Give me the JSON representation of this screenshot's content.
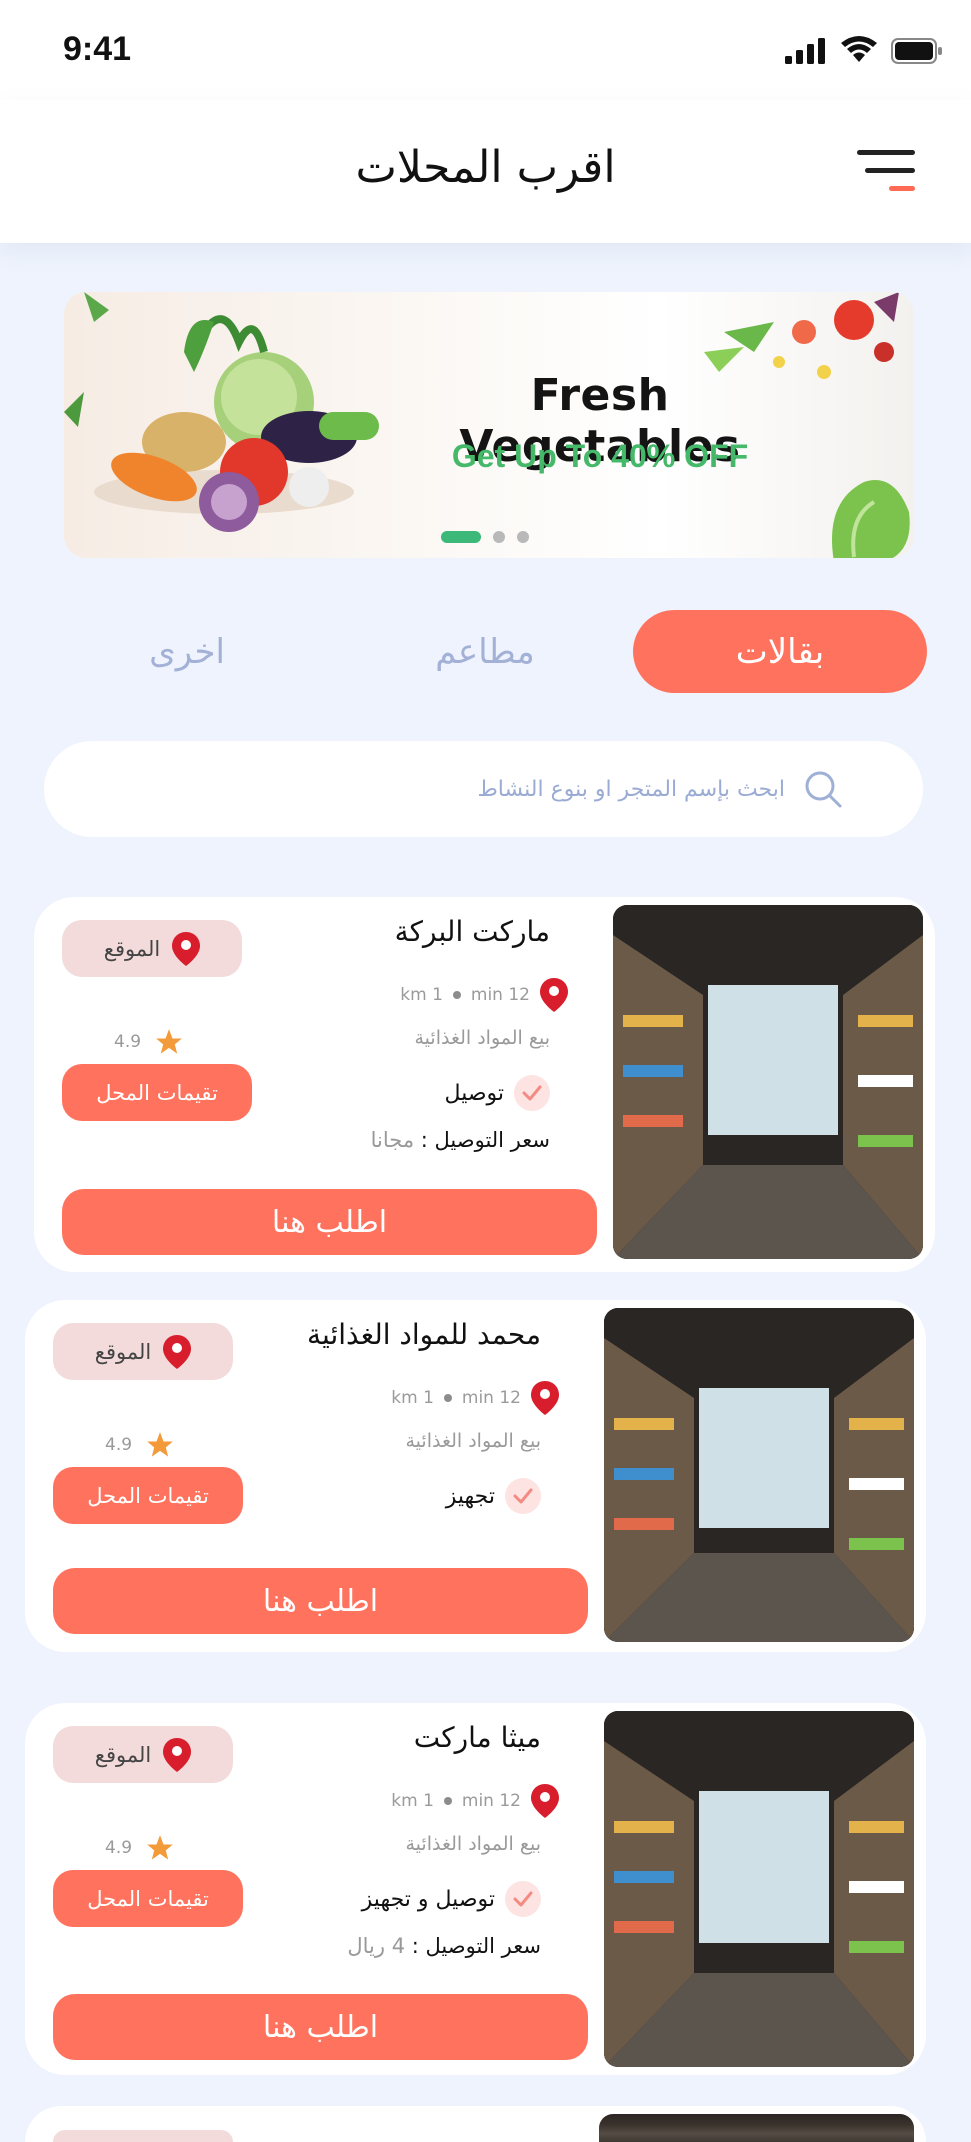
{
  "status_bar": {
    "time": "9:41"
  },
  "header": {
    "title": "اقرب المحلات"
  },
  "banner": {
    "title": "Fresh Vegetables",
    "subtitle": "Get Up To 40% OFF",
    "active_slide": 1,
    "slide_count": 3
  },
  "tabs": [
    {
      "label": "بقالات",
      "active": true
    },
    {
      "label": "مطاعم",
      "active": false
    },
    {
      "label": "اخرى",
      "active": false
    }
  ],
  "search": {
    "placeholder": "ابحث بإسم المتجر او بنوع النشاط",
    "value": ""
  },
  "colors": {
    "accent": "#ff735e",
    "location_chip": "#f3dbdb",
    "subtitle_green": "#45b86a",
    "pin_red": "#d81e2c",
    "star": "#f39b3b",
    "inactive_tab": "#a3b1d6"
  },
  "stores": [
    {
      "name": "ماركت البركة",
      "distance": "1 km",
      "time": "12 min",
      "category": "بيع المواد الغذائية",
      "service": "توصيل",
      "delivery_label": "سعر التوصيل : ",
      "delivery_value": "مجانا",
      "location_label": "الموقع",
      "rating": "4.9",
      "reviews_label": "تقيمات المحل",
      "order_label": "اطلب هنا"
    },
    {
      "name": "محمد للمواد الغذائية",
      "distance": "1 km",
      "time": "12 min",
      "category": "بيع المواد الغذائية",
      "service": "تجهيز",
      "location_label": "الموقع",
      "rating": "4.9",
      "reviews_label": "تقيمات المحل",
      "order_label": "اطلب هنا"
    },
    {
      "name": "ميثا ماركت",
      "distance": "1 km",
      "time": "12 min",
      "category": "بيع المواد الغذائية",
      "service": "توصيل و تجهيز",
      "delivery_label": "سعر التوصيل : ",
      "delivery_value": "4 ريال",
      "location_label": "الموقع",
      "rating": "4.9",
      "reviews_label": "تقيمات المحل",
      "order_label": "اطلب هنا"
    }
  ]
}
